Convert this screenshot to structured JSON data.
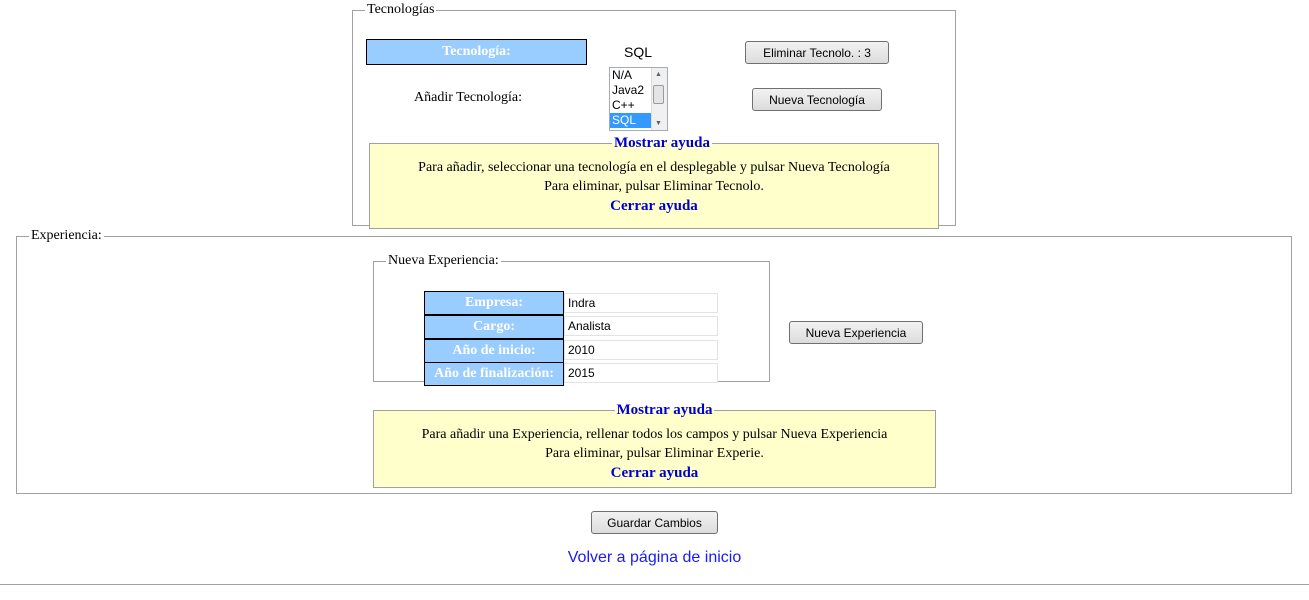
{
  "tecnologias": {
    "legend": "Tecnologías",
    "header_label": "Tecnología:",
    "selected_value": "SQL",
    "delete_button": "Eliminar Tecnolo. : 3",
    "add_label": "Añadir Tecnología:",
    "options": [
      "N/A",
      "Java2",
      "C++",
      "SQL"
    ],
    "selected_option": "SQL",
    "new_button": "Nueva Tecnología",
    "help": {
      "legend": "Mostrar ayuda",
      "line1": "Para añadir, seleccionar una tecnología en el desplegable y pulsar Nueva Tecnología",
      "line2": "Para eliminar, pulsar Eliminar Tecnolo.",
      "close": "Cerrar ayuda"
    }
  },
  "experiencia": {
    "legend": "Experiencia:",
    "nueva": {
      "legend": "Nueva Experiencia:",
      "fields": [
        {
          "label": "Empresa:",
          "value": "Indra"
        },
        {
          "label": "Cargo:",
          "value": "Analista"
        },
        {
          "label": "Año de inicio:",
          "value": "2010"
        },
        {
          "label": "Año de finalización:",
          "value": "2015"
        }
      ]
    },
    "new_button": "Nueva Experiencia",
    "help": {
      "legend": "Mostrar ayuda",
      "line1": "Para añadir una Experiencia, rellenar todos los campos y pulsar Nueva Experiencia",
      "line2": "Para eliminar, pulsar Eliminar Experie.",
      "close": "Cerrar ayuda"
    }
  },
  "save_button": "Guardar Cambios",
  "home_link": "Volver a página de inicio"
}
